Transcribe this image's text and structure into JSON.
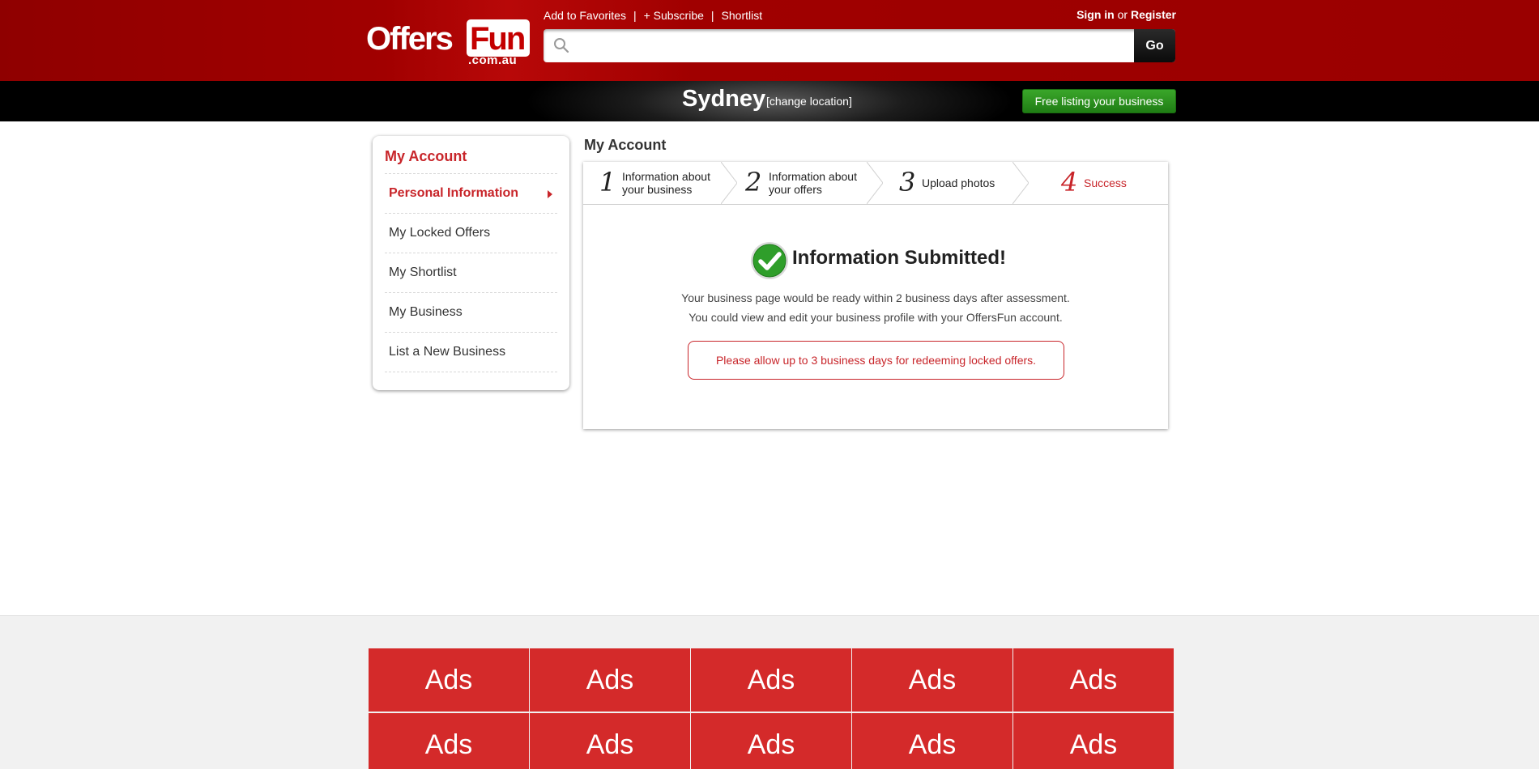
{
  "header": {
    "logo": {
      "main": "Offers",
      "highlight": "Fun",
      "domain": ".com.au"
    },
    "links": [
      "Add to Favorites",
      "+ Subscribe",
      "Shortlist"
    ],
    "auth": {
      "sign_in": "Sign in",
      "or": "or",
      "register": "Register"
    },
    "search": {
      "placeholder": "",
      "value": "",
      "go_label": "Go"
    }
  },
  "location": {
    "city": "Sydney",
    "change_label": "[change location]",
    "free_listing_label": "Free listing your business"
  },
  "sidebar": {
    "title": "My Account",
    "items": [
      {
        "label": "Personal Information",
        "active": true
      },
      {
        "label": "My Locked Offers",
        "active": false
      },
      {
        "label": "My Shortlist",
        "active": false
      },
      {
        "label": "My Business",
        "active": false
      },
      {
        "label": "List a New Business",
        "active": false
      }
    ]
  },
  "main": {
    "title": "My Account",
    "steps": [
      {
        "number": "1",
        "line1": "Information about",
        "line2": "your business"
      },
      {
        "number": "2",
        "line1": "Information about",
        "line2": "your offers"
      },
      {
        "number": "3",
        "line1": "Upload photos",
        "line2": ""
      },
      {
        "number": "4",
        "line1": "Success",
        "line2": ""
      }
    ],
    "active_step": 4,
    "success": {
      "title": "Information Submitted!",
      "line1": "Your business page would be ready within 2 business days after assessment.",
      "line2": "You could view and edit your business profile with your OffersFun account.",
      "notice": "Please allow up to 3 business days for redeeming locked offers."
    }
  },
  "footer": {
    "ads": [
      "Ads",
      "Ads",
      "Ads",
      "Ads",
      "Ads",
      "Ads",
      "Ads",
      "Ads",
      "Ads",
      "Ads"
    ]
  },
  "colors": {
    "brand_red": "#c8252a",
    "header_red": "#9a0000",
    "ad_red": "#d42a2a",
    "cta_green": "#2a961e"
  }
}
